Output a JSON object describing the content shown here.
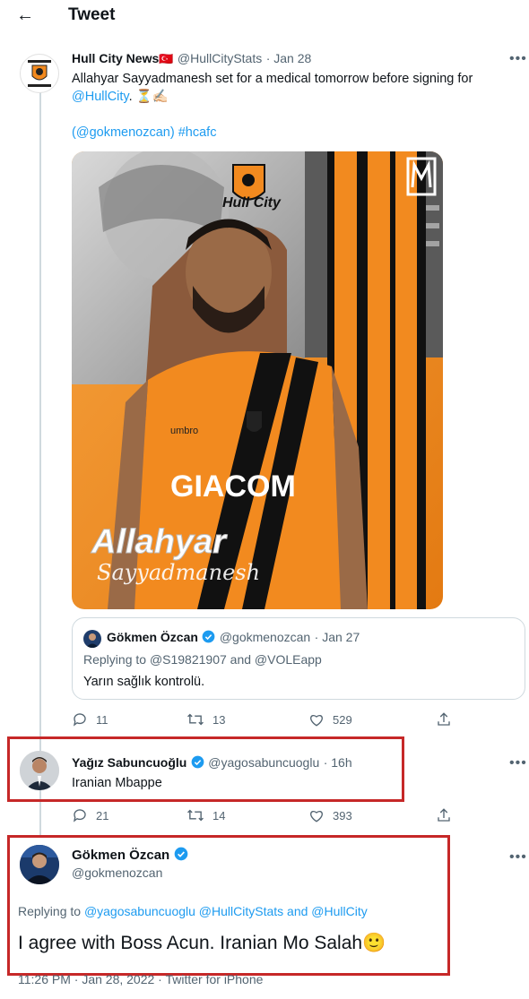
{
  "header": {
    "back_icon": "←",
    "title": "Tweet"
  },
  "tweet1": {
    "author_name": "Hull City News",
    "flag": "🇹🇷",
    "handle": "@HullCityStats",
    "date": "· Jan 28",
    "text_line1": "Allahyar Sayyadmanesh set for a medical tomorrow before signing for",
    "mention": "@HullCity",
    "text_after_mention": ". ⏳✍🏻",
    "credit_open": "(",
    "credit_handle": "@gokmenozcan",
    "credit_close": ")",
    "hashtag": "#hcafc",
    "more": "•••",
    "media": {
      "club_name": "Hull City",
      "sponsor": "GIACOM",
      "first_name": "Allahyar",
      "last_name": "Sayyadmanesh",
      "kit_brand": "umbro"
    },
    "quote": {
      "author_name": "Gökmen Özcan",
      "handle": "@gokmenozcan",
      "date": "· Jan 27",
      "replying_prefix": "Replying to",
      "replying_to": "@S19821907 and @VOLEapp",
      "text": "Yarın sağlık kontrolü."
    },
    "actions": {
      "replies": "11",
      "retweets": "13",
      "likes": "529"
    }
  },
  "tweet2": {
    "author_name": "Yağız Sabuncuoğlu",
    "handle": "@yagosabuncuoglu",
    "date": "· 16h",
    "text": "Iranian Mbappe",
    "more": "•••",
    "actions": {
      "replies": "21",
      "retweets": "14",
      "likes": "393"
    }
  },
  "tweet3": {
    "author_name": "Gökmen Özcan",
    "handle": "@gokmenozcan",
    "more": "•••",
    "replying_prefix": "Replying to",
    "replying_to": "@yagosabuncuoglu @HullCityStats and @HullCity",
    "text": "I agree with Boss Acun. Iranian Mo Salah",
    "emoji": "🙂",
    "footer": "11:26 PM · Jan 28, 2022 · Twitter for iPhone"
  },
  "colors": {
    "accent": "#1d9bf0",
    "highlight_box": "#c62828",
    "kit_orange": "#f28a1f"
  }
}
